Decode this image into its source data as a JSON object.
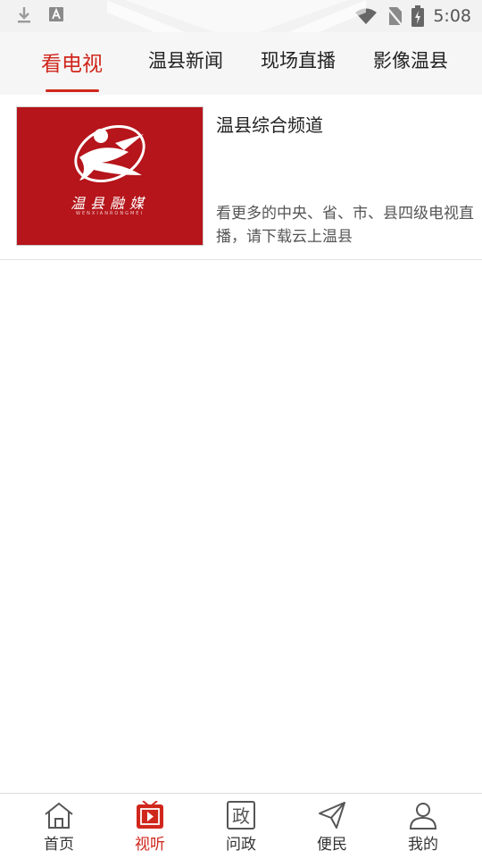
{
  "status_bar": {
    "time": "5:08"
  },
  "tabs": [
    {
      "label": "看电视"
    },
    {
      "label": "温县新闻"
    },
    {
      "label": "现场直播"
    },
    {
      "label": "影像温县"
    }
  ],
  "channel": {
    "title": "温县综合频道",
    "description": "看更多的中央、省、市、县四级电视直播，请下载云上温县",
    "logo_text": "温县融媒",
    "logo_subtext": "WENXIANRONGMEI"
  },
  "bottom_nav": [
    {
      "label": "首页",
      "icon": "home-icon"
    },
    {
      "label": "视听",
      "icon": "video-play-icon"
    },
    {
      "label": "问政",
      "icon": "zheng-icon",
      "glyph": "政"
    },
    {
      "label": "便民",
      "icon": "paper-plane-icon"
    },
    {
      "label": "我的",
      "icon": "user-icon"
    }
  ],
  "colors": {
    "accent": "#d0271d",
    "logo_bg": "#b5151b"
  }
}
